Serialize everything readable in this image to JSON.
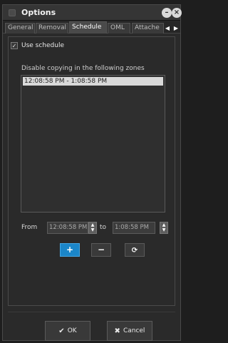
{
  "window": {
    "title": "Options"
  },
  "tabs": [
    {
      "label": "General",
      "active": false
    },
    {
      "label": "Removal",
      "active": false
    },
    {
      "label": "Schedule",
      "active": true
    },
    {
      "label": "OML",
      "active": false
    },
    {
      "label": "Attache",
      "active": false
    }
  ],
  "schedule": {
    "use_schedule_label": "Use schedule",
    "use_schedule_checked": true,
    "zones_label": "Disable copying in the following zones",
    "zones": [
      "12:08:58 PM - 1:08:58 PM"
    ],
    "from_label": "From",
    "from_value": "12:08:58 PM",
    "to_label": "to",
    "to_value": "1:08:58 PM"
  },
  "actions": {
    "add_symbol": "+",
    "remove_symbol": "−",
    "reset_symbol": "⟳"
  },
  "footer": {
    "ok_icon": "✔",
    "ok_label": "OK",
    "cancel_icon": "✖",
    "cancel_label": "Cancel"
  }
}
